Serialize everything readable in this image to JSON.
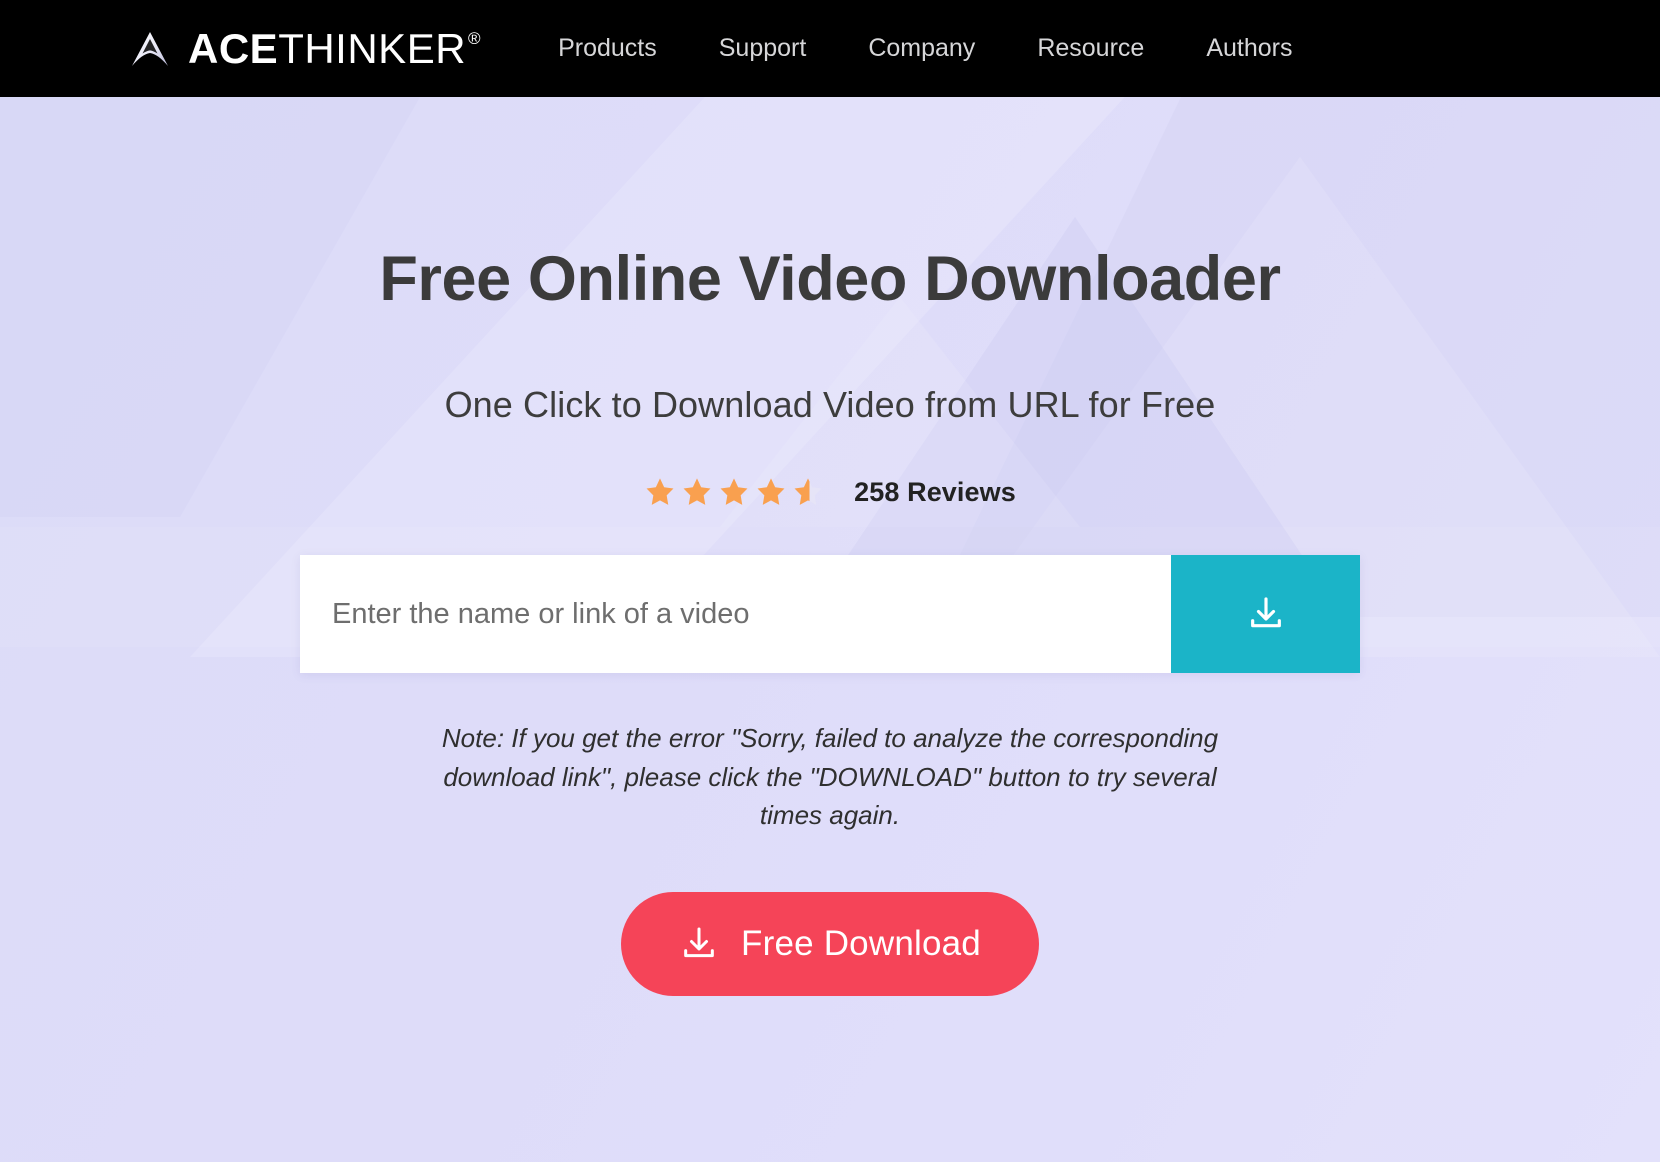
{
  "theme": {
    "nav_bg": "#000000",
    "hero_bg_start": "#dcdcf8",
    "hero_bg_end": "#e3e1fb",
    "accent_teal": "#1bb4c8",
    "accent_red": "#f54458",
    "star_color": "#f9a04f",
    "heading_color": "#3b3b3b"
  },
  "navbar": {
    "brand": {
      "icon": "acethinker-mountain-logo",
      "name_bold": "ACE",
      "name_light": "THINKER",
      "registered_mark": "®"
    },
    "links": [
      {
        "label": "Products"
      },
      {
        "label": "Support"
      },
      {
        "label": "Company"
      },
      {
        "label": "Resource"
      },
      {
        "label": "Authors"
      }
    ]
  },
  "hero": {
    "title": "Free Online Video Downloader",
    "subtitle": "One Click to Download Video from URL for Free",
    "rating": {
      "value": 4.5,
      "max": 5,
      "full_stars": 4,
      "half_stars": 1,
      "reviews_label": "258 Reviews"
    },
    "search": {
      "placeholder": "Enter the name or link of a video",
      "value": "",
      "button_icon": "download-icon"
    },
    "note": "Note: If you get the error \"Sorry, failed to analyze the corresponding download link\", please click the \"DOWNLOAD\" button to try several times again.",
    "cta": {
      "icon": "download-icon",
      "label": "Free Download"
    }
  }
}
